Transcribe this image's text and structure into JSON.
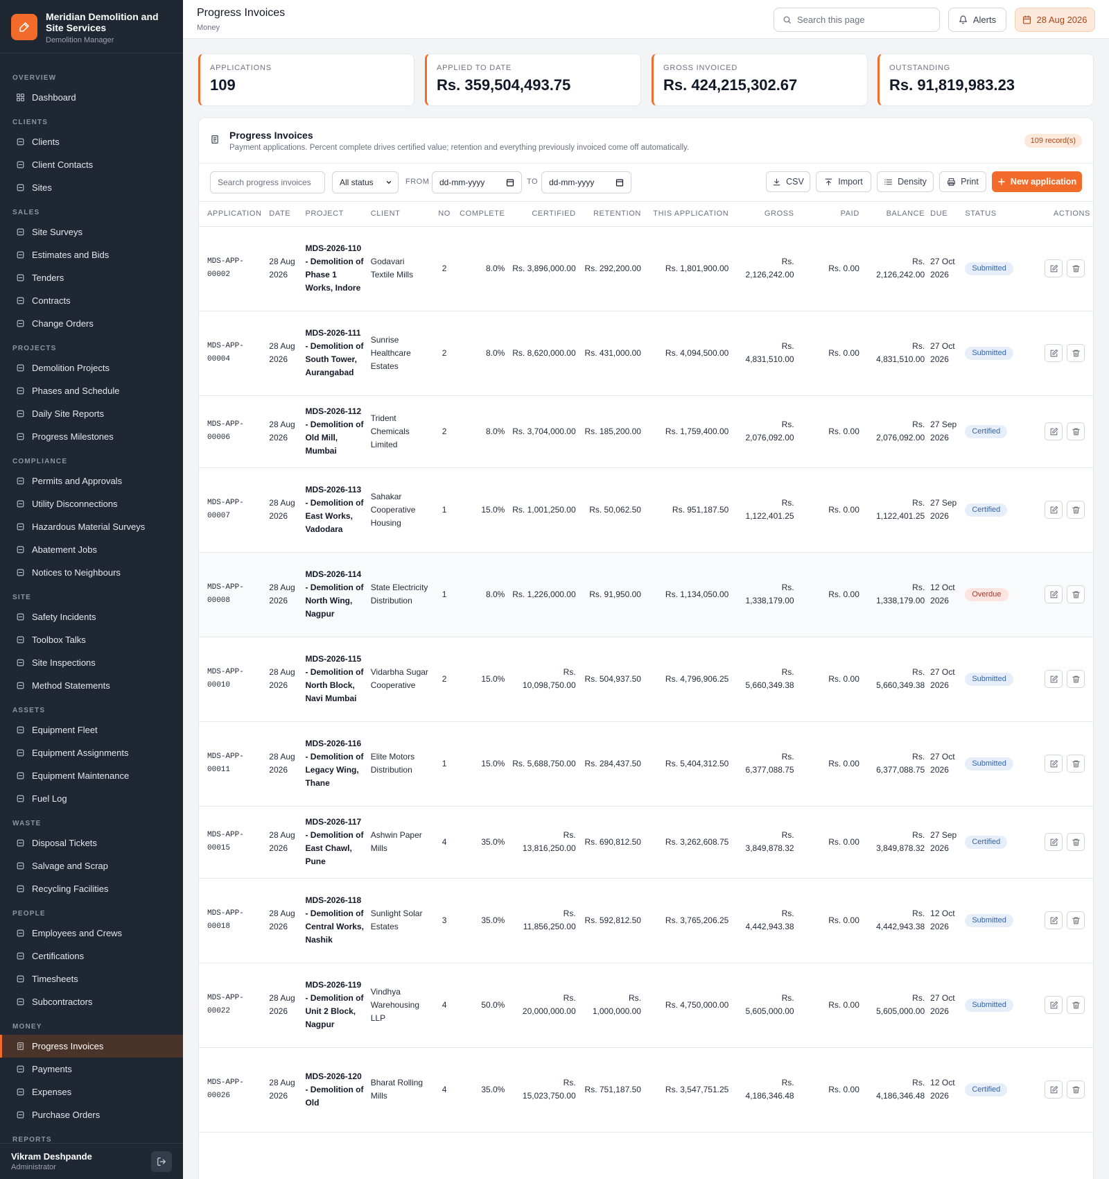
{
  "brand": {
    "name": "Meridian Demolition and Site Services",
    "subtitle": "Demolition Manager"
  },
  "sidebar": {
    "sections": [
      {
        "title": "OVERVIEW",
        "items": [
          {
            "label": "Dashboard",
            "icon": "grid-icon"
          }
        ]
      },
      {
        "title": "CLIENTS",
        "items": [
          {
            "label": "Clients",
            "icon": "users-icon"
          },
          {
            "label": "Client Contacts",
            "icon": "user-icon"
          },
          {
            "label": "Sites",
            "icon": "map-pin-icon"
          }
        ]
      },
      {
        "title": "SALES",
        "items": [
          {
            "label": "Site Surveys",
            "icon": "clipboard-icon"
          },
          {
            "label": "Estimates and Bids",
            "icon": "calculator-icon"
          },
          {
            "label": "Tenders",
            "icon": "file-icon"
          },
          {
            "label": "Contracts",
            "icon": "file-signature-icon"
          },
          {
            "label": "Change Orders",
            "icon": "refresh-icon"
          }
        ]
      },
      {
        "title": "PROJECTS",
        "items": [
          {
            "label": "Demolition Projects",
            "icon": "building-icon"
          },
          {
            "label": "Phases and Schedule",
            "icon": "layers-icon"
          },
          {
            "label": "Daily Site Reports",
            "icon": "notebook-icon"
          },
          {
            "label": "Progress Milestones",
            "icon": "flag-icon"
          }
        ]
      },
      {
        "title": "COMPLIANCE",
        "items": [
          {
            "label": "Permits and Approvals",
            "icon": "badge-icon"
          },
          {
            "label": "Utility Disconnections",
            "icon": "plug-icon"
          },
          {
            "label": "Hazardous Material Surveys",
            "icon": "alert-circle-icon"
          },
          {
            "label": "Abatement Jobs",
            "icon": "shield-check-icon"
          },
          {
            "label": "Notices to Neighbours",
            "icon": "bell-icon"
          }
        ]
      },
      {
        "title": "SITE",
        "items": [
          {
            "label": "Safety Incidents",
            "icon": "warning-triangle-icon"
          },
          {
            "label": "Toolbox Talks",
            "icon": "chat-icon"
          },
          {
            "label": "Site Inspections",
            "icon": "check-square-icon"
          },
          {
            "label": "Method Statements",
            "icon": "book-icon"
          }
        ]
      },
      {
        "title": "ASSETS",
        "items": [
          {
            "label": "Equipment Fleet",
            "icon": "truck-icon"
          },
          {
            "label": "Equipment Assignments",
            "icon": "link-icon"
          },
          {
            "label": "Equipment Maintenance",
            "icon": "wrench-icon"
          },
          {
            "label": "Fuel Log",
            "icon": "droplet-icon"
          }
        ]
      },
      {
        "title": "WASTE",
        "items": [
          {
            "label": "Disposal Tickets",
            "icon": "trash-icon"
          },
          {
            "label": "Salvage and Scrap",
            "icon": "recycle-icon"
          },
          {
            "label": "Recycling Facilities",
            "icon": "factory-icon"
          }
        ]
      },
      {
        "title": "PEOPLE",
        "items": [
          {
            "label": "Employees and Crews",
            "icon": "id-card-icon"
          },
          {
            "label": "Certifications",
            "icon": "award-icon"
          },
          {
            "label": "Timesheets",
            "icon": "clock-icon"
          },
          {
            "label": "Subcontractors",
            "icon": "briefcase-icon"
          }
        ]
      },
      {
        "title": "MONEY",
        "items": [
          {
            "label": "Progress Invoices",
            "icon": "receipt-icon",
            "active": true
          },
          {
            "label": "Payments",
            "icon": "credit-card-icon"
          },
          {
            "label": "Expenses",
            "icon": "wallet-icon"
          },
          {
            "label": "Purchase Orders",
            "icon": "cart-icon"
          }
        ]
      },
      {
        "title": "REPORTS",
        "items": []
      }
    ],
    "user": {
      "name": "Vikram Deshpande",
      "role": "Administrator"
    }
  },
  "topbar": {
    "title": "Progress Invoices",
    "breadcrumb": "Money",
    "search_placeholder": "Search this page",
    "alerts_label": "Alerts",
    "date": "28 Aug 2026"
  },
  "kpis": [
    {
      "label": "APPLICATIONS",
      "value": "109"
    },
    {
      "label": "APPLIED TO DATE",
      "value": "Rs. 359,504,493.75"
    },
    {
      "label": "GROSS INVOICED",
      "value": "Rs. 424,215,302.67"
    },
    {
      "label": "OUTSTANDING",
      "value": "Rs. 91,819,983.23"
    }
  ],
  "panel": {
    "title": "Progress Invoices",
    "description": "Payment applications. Percent complete drives certified value; retention and everything previously invoiced come off automatically.",
    "records": "109 record(s)"
  },
  "toolbar": {
    "search_placeholder": "Search progress invoices",
    "status_filter": "All status",
    "from_label": "FROM",
    "to_label": "TO",
    "date_placeholder": "dd-mm-yyyy",
    "csv": "CSV",
    "import": "Import",
    "density": "Density",
    "print": "Print",
    "new": "New application"
  },
  "table": {
    "columns": [
      "APPLICATION",
      "DATE",
      "PROJECT",
      "CLIENT",
      "NO",
      "COMPLETE",
      "CERTIFIED",
      "RETENTION",
      "THIS APPLICATION",
      "GROSS",
      "PAID",
      "BALANCE",
      "DUE",
      "STATUS",
      "ACTIONS"
    ],
    "rows": [
      {
        "app": "MDS-APP-00002",
        "date": "28 Aug 2026",
        "project": "MDS-2026-110 - Demolition of Phase 1 Works, Indore",
        "client": "Godavari Textile Mills",
        "no": "2",
        "complete": "8.0%",
        "certified": "Rs. 3,896,000.00",
        "retention": "Rs. 292,200.00",
        "this_app": "Rs. 1,801,900.00",
        "gross": "Rs. 2,126,242.00",
        "paid": "Rs. 0.00",
        "balance": "Rs. 2,126,242.00",
        "due": "27 Oct 2026",
        "status": "Submitted"
      },
      {
        "app": "MDS-APP-00004",
        "date": "28 Aug 2026",
        "project": "MDS-2026-111 - Demolition of South Tower, Aurangabad",
        "client": "Sunrise Healthcare Estates",
        "no": "2",
        "complete": "8.0%",
        "certified": "Rs. 8,620,000.00",
        "retention": "Rs. 431,000.00",
        "this_app": "Rs. 4,094,500.00",
        "gross": "Rs. 4,831,510.00",
        "paid": "Rs. 0.00",
        "balance": "Rs. 4,831,510.00",
        "due": "27 Oct 2026",
        "status": "Submitted"
      },
      {
        "app": "MDS-APP-00006",
        "date": "28 Aug 2026",
        "project": "MDS-2026-112 - Demolition of Old Mill, Mumbai",
        "client": "Trident Chemicals Limited",
        "no": "2",
        "complete": "8.0%",
        "certified": "Rs. 3,704,000.00",
        "retention": "Rs. 185,200.00",
        "this_app": "Rs. 1,759,400.00",
        "gross": "Rs. 2,076,092.00",
        "paid": "Rs. 0.00",
        "balance": "Rs. 2,076,092.00",
        "due": "27 Sep 2026",
        "status": "Certified"
      },
      {
        "app": "MDS-APP-00007",
        "date": "28 Aug 2026",
        "project": "MDS-2026-113 - Demolition of East Works, Vadodara",
        "client": "Sahakar Cooperative Housing",
        "no": "1",
        "complete": "15.0%",
        "certified": "Rs. 1,001,250.00",
        "retention": "Rs. 50,062.50",
        "this_app": "Rs. 951,187.50",
        "gross": "Rs. 1,122,401.25",
        "paid": "Rs. 0.00",
        "balance": "Rs. 1,122,401.25",
        "due": "27 Sep 2026",
        "status": "Certified"
      },
      {
        "app": "MDS-APP-00008",
        "date": "28 Aug 2026",
        "project": "MDS-2026-114 - Demolition of North Wing, Nagpur",
        "client": "State Electricity Distribution",
        "no": "1",
        "complete": "8.0%",
        "certified": "Rs. 1,226,000.00",
        "retention": "Rs. 91,950.00",
        "this_app": "Rs. 1,134,050.00",
        "gross": "Rs. 1,338,179.00",
        "paid": "Rs. 0.00",
        "balance": "Rs. 1,338,179.00",
        "due": "12 Oct 2026",
        "status": "Overdue",
        "highlight": true
      },
      {
        "app": "MDS-APP-00010",
        "date": "28 Aug 2026",
        "project": "MDS-2026-115 - Demolition of North Block, Navi Mumbai",
        "client": "Vidarbha Sugar Cooperative",
        "no": "2",
        "complete": "15.0%",
        "certified": "Rs. 10,098,750.00",
        "retention": "Rs. 504,937.50",
        "this_app": "Rs. 4,796,906.25",
        "gross": "Rs. 5,660,349.38",
        "paid": "Rs. 0.00",
        "balance": "Rs. 5,660,349.38",
        "due": "27 Oct 2026",
        "status": "Submitted"
      },
      {
        "app": "MDS-APP-00011",
        "date": "28 Aug 2026",
        "project": "MDS-2026-116 - Demolition of Legacy Wing, Thane",
        "client": "Elite Motors Distribution",
        "no": "1",
        "complete": "15.0%",
        "certified": "Rs. 5,688,750.00",
        "retention": "Rs. 284,437.50",
        "this_app": "Rs. 5,404,312.50",
        "gross": "Rs. 6,377,088.75",
        "paid": "Rs. 0.00",
        "balance": "Rs. 6,377,088.75",
        "due": "27 Oct 2026",
        "status": "Submitted"
      },
      {
        "app": "MDS-APP-00015",
        "date": "28 Aug 2026",
        "project": "MDS-2026-117 - Demolition of East Chawl, Pune",
        "client": "Ashwin Paper Mills",
        "no": "4",
        "complete": "35.0%",
        "certified": "Rs. 13,816,250.00",
        "retention": "Rs. 690,812.50",
        "this_app": "Rs. 3,262,608.75",
        "gross": "Rs. 3,849,878.32",
        "paid": "Rs. 0.00",
        "balance": "Rs. 3,849,878.32",
        "due": "27 Sep 2026",
        "status": "Certified"
      },
      {
        "app": "MDS-APP-00018",
        "date": "28 Aug 2026",
        "project": "MDS-2026-118 - Demolition of Central Works, Nashik",
        "client": "Sunlight Solar Estates",
        "no": "3",
        "complete": "35.0%",
        "certified": "Rs. 11,856,250.00",
        "retention": "Rs. 592,812.50",
        "this_app": "Rs. 3,765,206.25",
        "gross": "Rs. 4,442,943.38",
        "paid": "Rs. 0.00",
        "balance": "Rs. 4,442,943.38",
        "due": "12 Oct 2026",
        "status": "Submitted"
      },
      {
        "app": "MDS-APP-00022",
        "date": "28 Aug 2026",
        "project": "MDS-2026-119 - Demolition of Unit 2 Block, Nagpur",
        "client": "Vindhya Warehousing LLP",
        "no": "4",
        "complete": "50.0%",
        "certified": "Rs. 20,000,000.00",
        "retention": "Rs. 1,000,000.00",
        "this_app": "Rs. 4,750,000.00",
        "gross": "Rs. 5,605,000.00",
        "paid": "Rs. 0.00",
        "balance": "Rs. 5,605,000.00",
        "due": "27 Oct 2026",
        "status": "Submitted"
      },
      {
        "app": "MDS-APP-00026",
        "date": "28 Aug 2026",
        "project": "MDS-2026-120 - Demolition of Old",
        "client": "Bharat Rolling Mills",
        "no": "4",
        "complete": "35.0%",
        "certified": "Rs. 15,023,750.00",
        "retention": "Rs. 751,187.50",
        "this_app": "Rs. 3,547,751.25",
        "gross": "Rs. 4,186,346.48",
        "paid": "Rs. 0.00",
        "balance": "Rs. 4,186,346.48",
        "due": "12 Oct 2026",
        "status": "Certified"
      }
    ]
  },
  "colors": {
    "accent": "#f26b2a",
    "sidebar_bg": "#1f2733",
    "status_blue": "#3563a8",
    "status_red": "#b4321f"
  }
}
